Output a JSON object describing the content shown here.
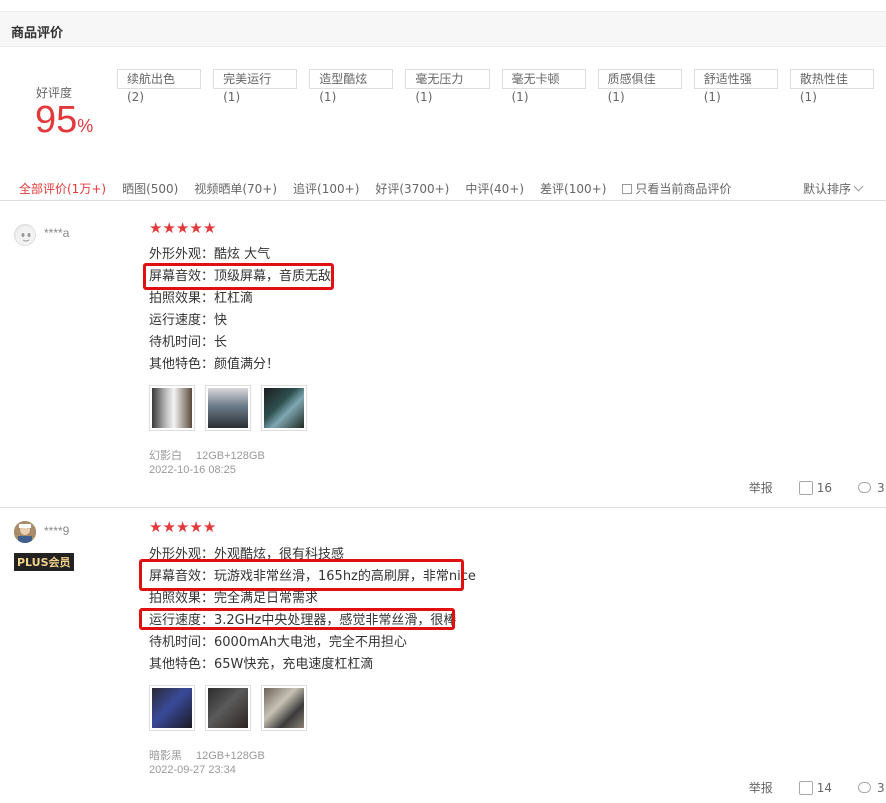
{
  "header": {
    "title": "商品评价"
  },
  "rating": {
    "label": "好评度",
    "value": "95",
    "unit": "%"
  },
  "tags": [
    "续航出色(2)",
    "完美运行(1)",
    "造型酷炫(1)",
    "毫无压力(1)",
    "毫无卡顿(1)",
    "质感俱佳(1)",
    "舒适性强(1)",
    "散热性佳(1)"
  ],
  "filters": {
    "items": [
      "全部评价(1万+)",
      "晒图(500)",
      "视频晒单(70+)",
      "追评(100+)",
      "好评(3700+)",
      "中评(40+)",
      "差评(100+)"
    ],
    "only_current": "只看当前商品评价",
    "sort": "默认排序"
  },
  "colors": {
    "accent": "#e4393c",
    "highlight_box": "#e01010"
  },
  "reviews": [
    {
      "user": "****a",
      "badge": "",
      "stars": 5,
      "lines": [
        "外形外观：酷炫 大气",
        "屏幕音效：顶级屏幕，音质无敌",
        "拍照效果：杠杠滴",
        "运行速度：快",
        "待机时间：长",
        "其他特色：颜值满分！"
      ],
      "variant": "幻影白",
      "spec": "12GB+128GB",
      "date": "2022-10-16 08:25",
      "report": "举报",
      "likes": "16",
      "comments": "3"
    },
    {
      "user": "****9",
      "badge": "PLUS会员",
      "stars": 5,
      "lines": [
        "外形外观：外观酷炫，很有科技感",
        "屏幕音效：玩游戏非常丝滑，165hz的高刷屏，非常nice",
        "拍照效果：完全满足日常需求",
        "运行速度：3.2GHz中央处理器，感觉非常丝滑，很棒",
        "待机时间：6000mAh大电池，完全不用担心",
        "其他特色：65W快充，充电速度杠杠滴"
      ],
      "variant": "暗影黑",
      "spec": "12GB+128GB",
      "date": "2022-09-27 23:34",
      "report": "举报",
      "likes": "14",
      "comments": "3"
    }
  ]
}
